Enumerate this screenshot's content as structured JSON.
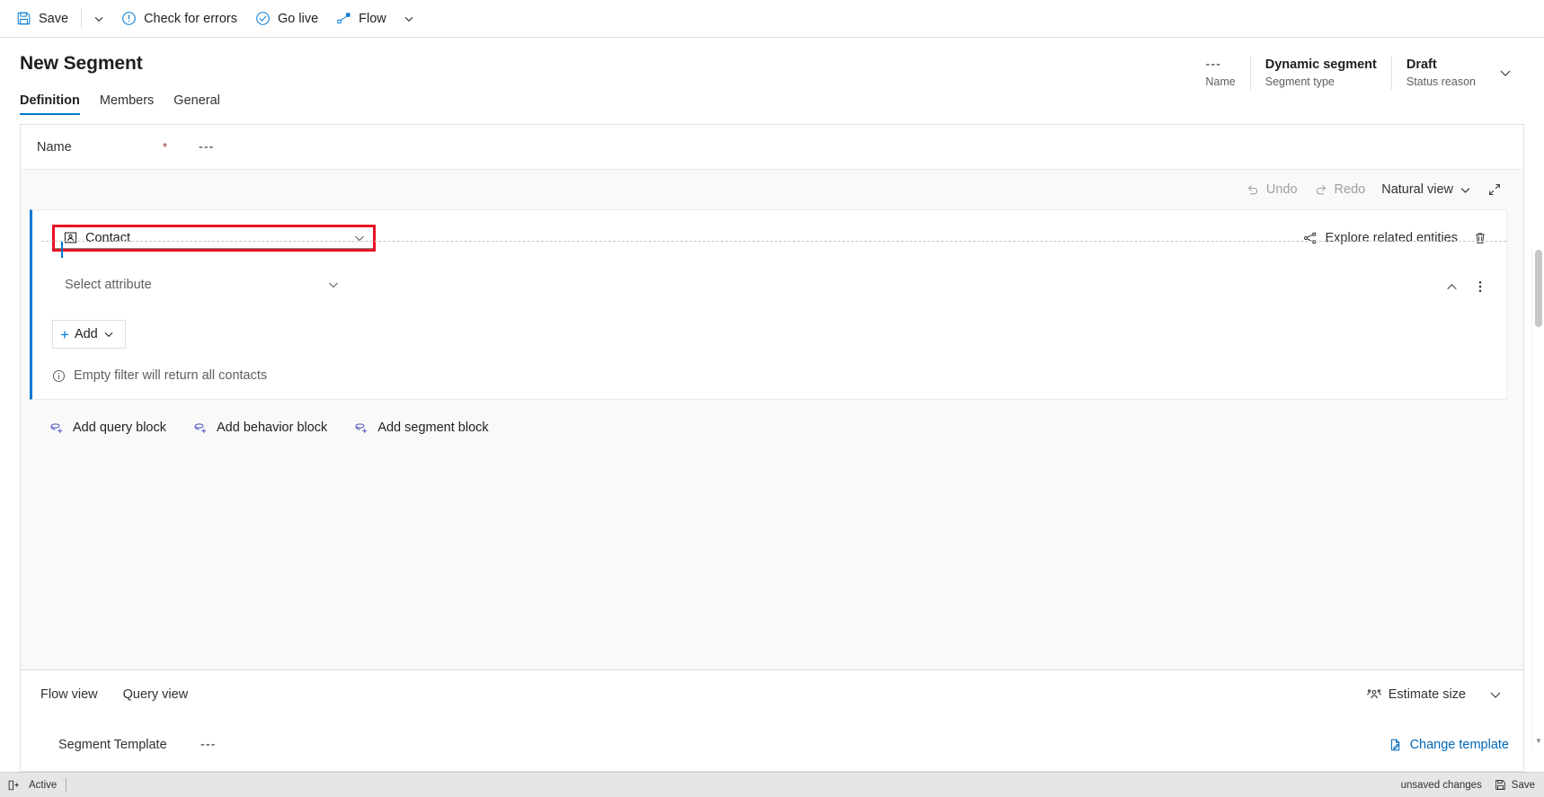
{
  "commandbar": {
    "items": [
      {
        "label": "Save",
        "icon": "save-icon"
      },
      {
        "label": "Check for errors",
        "icon": "error-circle-icon"
      },
      {
        "label": "Go live",
        "icon": "check-circle-icon"
      },
      {
        "label": "Flow",
        "icon": "flow-icon"
      }
    ]
  },
  "header": {
    "title": "New Segment",
    "tabs": [
      {
        "label": "Definition",
        "active": true
      },
      {
        "label": "Members",
        "active": false
      },
      {
        "label": "General",
        "active": false
      }
    ],
    "meta": [
      {
        "value": "---",
        "label": "Name"
      },
      {
        "value": "Dynamic segment",
        "label": "Segment type"
      },
      {
        "value": "Draft",
        "label": "Status reason"
      }
    ]
  },
  "form": {
    "name_label": "Name",
    "name_required": "*",
    "name_value": "---"
  },
  "canvas": {
    "toolbar": {
      "undo": "Undo",
      "redo": "Redo",
      "view_mode": "Natural view"
    },
    "block": {
      "entity": "Contact",
      "explore_label": "Explore related entities",
      "attribute_placeholder": "Select attribute",
      "add_label": "Add",
      "hint": "Empty filter will return all contacts"
    },
    "add_blocks": [
      {
        "label": "Add query block"
      },
      {
        "label": "Add behavior block"
      },
      {
        "label": "Add segment block"
      }
    ]
  },
  "bottom": {
    "views": [
      {
        "label": "Flow view"
      },
      {
        "label": "Query view"
      }
    ],
    "estimate_label": "Estimate size",
    "template_label": "Segment Template",
    "template_value": "---",
    "change_template_label": "Change template"
  },
  "statusbar": {
    "state": "Active",
    "unsaved": "unsaved changes",
    "save": "Save"
  },
  "colors": {
    "accent": "#0078d4",
    "highlight": "#e81123",
    "required": "#a4262c",
    "link": "#0067b8"
  }
}
